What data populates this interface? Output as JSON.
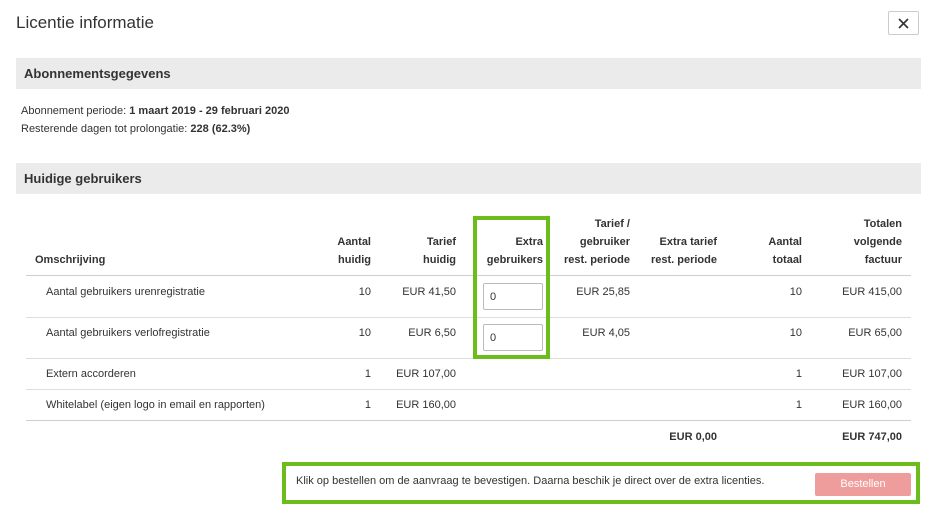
{
  "modal": {
    "title": "Licentie informatie"
  },
  "subscription": {
    "header": "Abonnementsgegevens",
    "period_label": "Abonnement periode: ",
    "period_value": "1 maart 2019 - 29 februari 2020",
    "remaining_label": "Resterende dagen tot prolongatie: ",
    "remaining_value": "228 (62.3%)"
  },
  "users": {
    "header": "Huidige gebruikers",
    "columns": {
      "description": "Omschrijving",
      "count_current": [
        "Aantal",
        "huidig"
      ],
      "rate_current": [
        "Tarief",
        "huidig"
      ],
      "extra_users": [
        "Extra",
        "gebruikers"
      ],
      "rate_per_user": [
        "Tarief /",
        "gebruiker",
        "rest. periode"
      ],
      "extra_rate": [
        "Extra tarief",
        "rest. periode"
      ],
      "count_total": [
        "Aantal",
        "totaal"
      ],
      "totals_next": [
        "Totalen",
        "volgende",
        "factuur"
      ]
    },
    "rows": [
      {
        "description": "Aantal gebruikers urenregistratie",
        "count_current": "10",
        "rate_current": "EUR 41,50",
        "extra_users": "0",
        "rate_per_user": "EUR 25,85",
        "extra_rate": "",
        "count_total": "10",
        "total_next": "EUR 415,00"
      },
      {
        "description": "Aantal gebruikers verlofregistratie",
        "count_current": "10",
        "rate_current": "EUR 6,50",
        "extra_users": "0",
        "rate_per_user": "EUR 4,05",
        "extra_rate": "",
        "count_total": "10",
        "total_next": "EUR 65,00"
      },
      {
        "description": "Extern accorderen",
        "count_current": "1",
        "rate_current": "EUR 107,00",
        "extra_users": "",
        "rate_per_user": "",
        "extra_rate": "",
        "count_total": "1",
        "total_next": "EUR 107,00"
      },
      {
        "description": "Whitelabel (eigen logo in email en rapporten)",
        "count_current": "1",
        "rate_current": "EUR 160,00",
        "extra_users": "",
        "rate_per_user": "",
        "extra_rate": "",
        "count_total": "1",
        "total_next": "EUR 160,00"
      }
    ],
    "totals": {
      "extra_rate": "EUR 0,00",
      "total_next": "EUR 747,00"
    }
  },
  "footer": {
    "message": "Klik op bestellen om de aanvraag te bevestigen. Daarna beschik je direct over de extra licenties.",
    "order_button": "Bestellen"
  },
  "colors": {
    "highlight": "#6cbd1c",
    "order_button": "#ee9c9c",
    "section_bg": "#ebebeb"
  }
}
